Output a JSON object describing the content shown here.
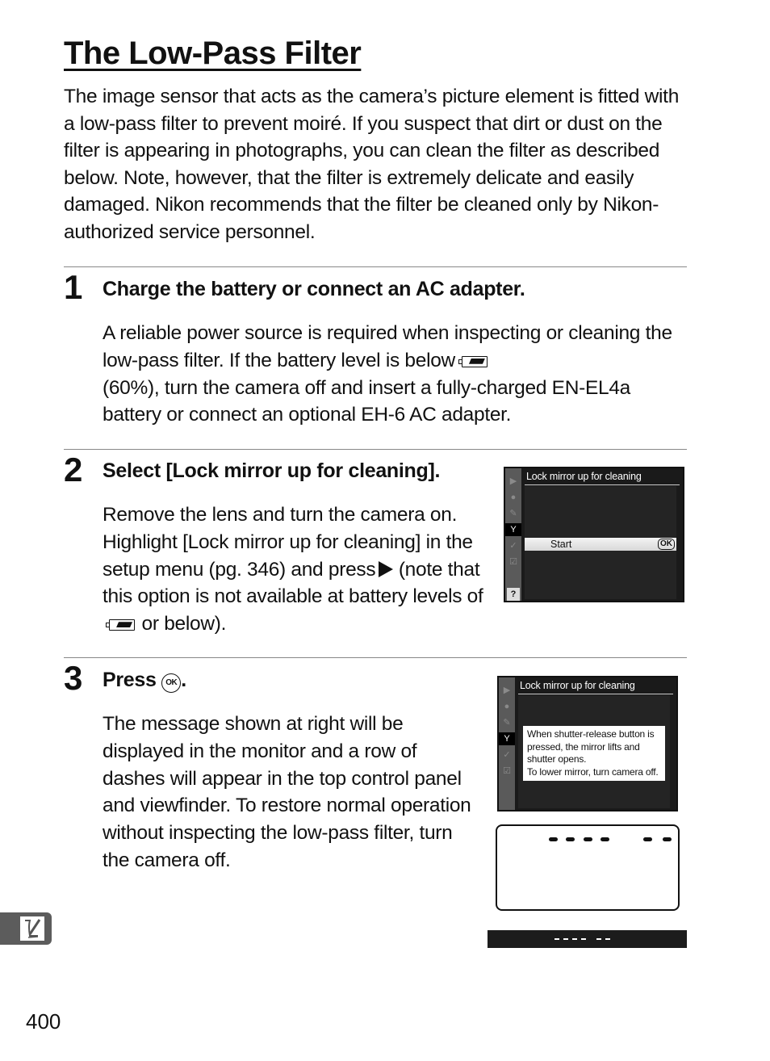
{
  "page": {
    "title": "The Low-Pass Filter",
    "intro": "The image sensor that acts as the camera’s picture element is fitted with a low-pass filter to prevent moiré.  If you suspect that dirt or dust on the filter is appearing in photographs, you can clean the filter as described below.  Note, however, that the filter is extremely delicate and easily damaged.  Nikon recommends that the filter be cleaned only by Nikon-authorized service personnel.",
    "page_number": "400"
  },
  "steps": [
    {
      "number": "1",
      "heading": "Charge the battery or connect an AC adapter.",
      "body_part1": "A reliable power source is required when inspecting or cleaning the low-pass filter.  If the battery level is below",
      "battery_icon": "battery-60-percent-icon",
      "body_part2": "(60%), turn the camera off and insert a fully-charged EN-EL4a battery or connect an optional EH-6 AC adapter."
    },
    {
      "number": "2",
      "heading": "Select [Lock mirror up for cleaning].",
      "body_part1": "Remove the lens and turn the camera on. Highlight [Lock mirror up for cleaning] in the setup menu (pg. 346) and press",
      "arrow_icon": "right-arrow-icon",
      "body_part2": "(note that this option is not available at battery levels of",
      "battery_icon": "battery-60-percent-icon",
      "body_part3": "or below).",
      "screen": {
        "title": "Lock mirror up for cleaning",
        "option_label": "Start",
        "option_button": "OK",
        "side_icons": [
          "playback-icon",
          "shooting-icon",
          "custom-settings-icon",
          "setup-wrench-icon",
          "retouch-icon",
          "my-menu-icon",
          "help-icon"
        ],
        "active_icon": "setup-wrench-icon",
        "help_label": "?"
      }
    },
    {
      "number": "3",
      "heading_prefix": "Press",
      "heading_button": "OK",
      "heading_suffix": ".",
      "body": "The message shown at right will be displayed in the monitor and a row of dashes will appear in the top control panel and viewfinder.  To restore normal operation without inspecting the low-pass filter, turn the camera off.",
      "screen": {
        "title": "Lock mirror up for cleaning",
        "message_lines": [
          "When shutter-release button is",
          "pressed, the mirror lifts and",
          "shutter opens.",
          "To lower mirror, turn camera off."
        ],
        "side_icons": [
          "playback-icon",
          "shooting-icon",
          "custom-settings-icon",
          "setup-wrench-icon",
          "retouch-icon",
          "my-menu-icon"
        ],
        "active_icon": "setup-wrench-icon"
      },
      "control_panel_display": "---- --",
      "viewfinder_display": "---- --"
    }
  ],
  "section_tab": {
    "icon": "notes-pencil-icon"
  }
}
